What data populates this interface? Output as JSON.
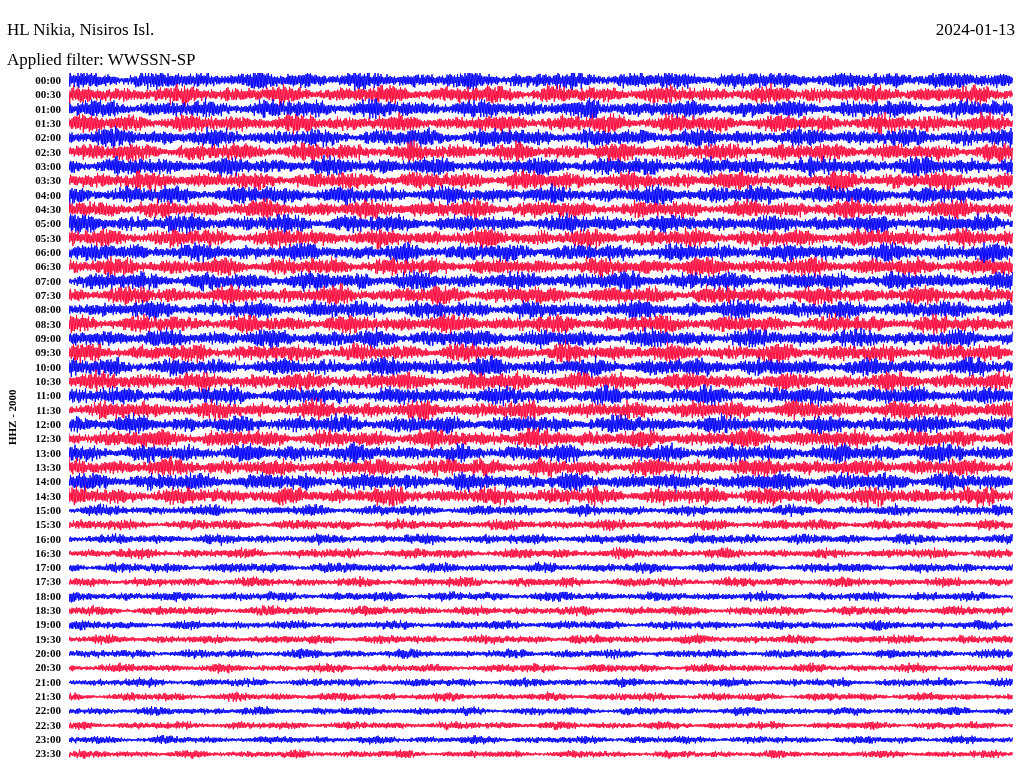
{
  "header": {
    "station": "HL Nikia, Nisiros Isl.",
    "filter": "Applied filter: WWSSN-SP",
    "date": "2024-01-13"
  },
  "axis_label": "HHZ - 2000",
  "rows": [
    {
      "time": "00:00",
      "color": "#0000ff"
    },
    {
      "time": "00:30",
      "color": "#ff0a3c"
    },
    {
      "time": "01:00",
      "color": "#0000ff"
    },
    {
      "time": "01:30",
      "color": "#ff0a3c"
    },
    {
      "time": "02:00",
      "color": "#0000ff"
    },
    {
      "time": "02:30",
      "color": "#ff0a3c"
    },
    {
      "time": "03:00",
      "color": "#0000ff"
    },
    {
      "time": "03:30",
      "color": "#ff0a3c"
    },
    {
      "time": "04:00",
      "color": "#0000ff"
    },
    {
      "time": "04:30",
      "color": "#ff0a3c"
    },
    {
      "time": "05:00",
      "color": "#0000ff"
    },
    {
      "time": "05:30",
      "color": "#ff0a3c"
    },
    {
      "time": "06:00",
      "color": "#0000ff"
    },
    {
      "time": "06:30",
      "color": "#ff0a3c"
    },
    {
      "time": "07:00",
      "color": "#0000ff"
    },
    {
      "time": "07:30",
      "color": "#ff0a3c"
    },
    {
      "time": "08:00",
      "color": "#0000ff"
    },
    {
      "time": "08:30",
      "color": "#ff0a3c"
    },
    {
      "time": "09:00",
      "color": "#0000ff"
    },
    {
      "time": "09:30",
      "color": "#ff0a3c"
    },
    {
      "time": "10:00",
      "color": "#0000ff"
    },
    {
      "time": "10:30",
      "color": "#ff0a3c"
    },
    {
      "time": "11:00",
      "color": "#0000ff"
    },
    {
      "time": "11:30",
      "color": "#ff0a3c"
    },
    {
      "time": "12:00",
      "color": "#0000ff"
    },
    {
      "time": "12:30",
      "color": "#ff0a3c"
    },
    {
      "time": "13:00",
      "color": "#0000ff"
    },
    {
      "time": "13:30",
      "color": "#ff0a3c"
    },
    {
      "time": "14:00",
      "color": "#0000ff"
    },
    {
      "time": "14:30",
      "color": "#ff0a3c"
    },
    {
      "time": "15:00",
      "color": "#0000ff"
    },
    {
      "time": "15:30",
      "color": "#ff0a3c"
    },
    {
      "time": "16:00",
      "color": "#0000ff"
    },
    {
      "time": "16:30",
      "color": "#ff0a3c"
    },
    {
      "time": "17:00",
      "color": "#0000ff"
    },
    {
      "time": "17:30",
      "color": "#ff0a3c"
    },
    {
      "time": "18:00",
      "color": "#0000ff"
    },
    {
      "time": "18:30",
      "color": "#ff0a3c"
    },
    {
      "time": "19:00",
      "color": "#0000ff"
    },
    {
      "time": "19:30",
      "color": "#ff0a3c"
    },
    {
      "time": "20:00",
      "color": "#0000ff"
    },
    {
      "time": "20:30",
      "color": "#ff0a3c"
    },
    {
      "time": "21:00",
      "color": "#0000ff"
    },
    {
      "time": "21:30",
      "color": "#ff0a3c"
    },
    {
      "time": "22:00",
      "color": "#0000ff"
    },
    {
      "time": "22:30",
      "color": "#ff0a3c"
    },
    {
      "time": "23:00",
      "color": "#0000ff"
    },
    {
      "time": "23:30",
      "color": "#ff0a3c"
    }
  ]
}
